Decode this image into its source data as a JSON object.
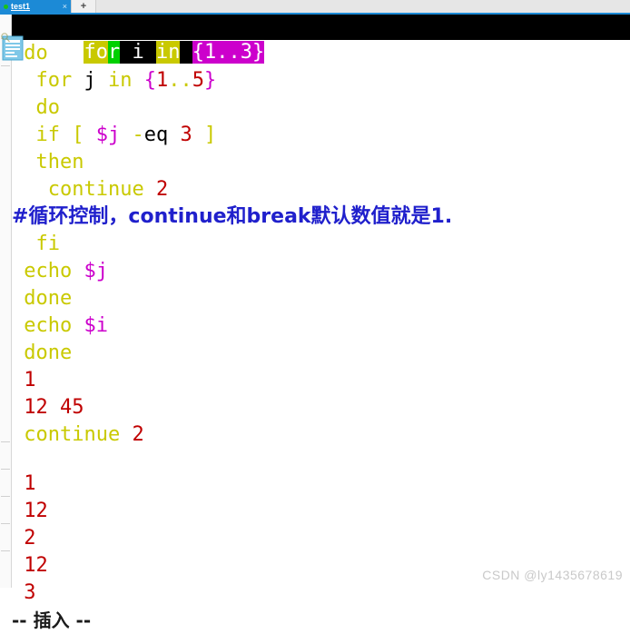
{
  "window": {
    "tab": {
      "label": "test1",
      "close_label": "×",
      "new_tab_label": "+",
      "dot_color": "#19c219",
      "active_color": "#1c8ad6"
    }
  },
  "terminal": {
    "cursor_line": {
      "segments": [
        {
          "text": "fo",
          "style": "hl-yellow"
        },
        {
          "text": "r",
          "style": "hl-green"
        },
        {
          "text": " i ",
          "style": "hl-black"
        },
        {
          "text": "in",
          "style": "hl-yellow"
        },
        {
          "text": " ",
          "style": "hl-black"
        },
        {
          "text": "{",
          "style": "hl-magenta"
        },
        {
          "text": "1..3",
          "style": "hl-magenta"
        },
        {
          "text": "}",
          "style": "hl-magenta"
        }
      ],
      "plain_text": "for i in {1..3}"
    },
    "lines": [
      {
        "id": "l-do-1",
        "text": " do",
        "kind": "code"
      },
      {
        "id": "l-for-j",
        "text": "  for j in {1..5}",
        "kind": "code"
      },
      {
        "id": "l-do-2",
        "text": "  do",
        "kind": "code"
      },
      {
        "id": "l-if",
        "text": "  if [ $j -eq 3 ]",
        "kind": "code"
      },
      {
        "id": "l-then",
        "text": "  then",
        "kind": "code"
      },
      {
        "id": "l-continue",
        "text": "   continue 2",
        "kind": "code"
      },
      {
        "id": "l-comment",
        "text": "#循环控制，continue和break默认数值就是1.",
        "kind": "comment"
      },
      {
        "id": "l-fi",
        "text": "  fi",
        "kind": "code"
      },
      {
        "id": "l-echo-j",
        "text": " echo $j",
        "kind": "code"
      },
      {
        "id": "l-done-1",
        "text": " done",
        "kind": "code"
      },
      {
        "id": "l-echo-i",
        "text": " echo $i",
        "kind": "code"
      },
      {
        "id": "l-done-2",
        "text": " done",
        "kind": "code"
      },
      {
        "id": "l-out-1",
        "text": " 1",
        "kind": "output"
      },
      {
        "id": "l-out-1245",
        "text": " 12 45",
        "kind": "output"
      },
      {
        "id": "l-out-cont2",
        "text": " continue 2",
        "kind": "output-kw"
      },
      {
        "id": "l-blank-1",
        "text": "",
        "kind": "blank"
      },
      {
        "id": "l-out-2",
        "text": " 1",
        "kind": "output"
      },
      {
        "id": "l-out-3",
        "text": " 12",
        "kind": "output"
      },
      {
        "id": "l-out-4",
        "text": " 2",
        "kind": "output"
      },
      {
        "id": "l-out-5",
        "text": " 12",
        "kind": "output"
      },
      {
        "id": "l-out-6",
        "text": " 3",
        "kind": "output"
      }
    ],
    "status": "-- 插入 --",
    "colors": {
      "keyword": "#c9c900",
      "variable": "#cc00cc",
      "number": "#c00000",
      "comment": "#2020cc",
      "background": "#ffffff"
    }
  },
  "watermark": "CSDN @ly1435678619"
}
